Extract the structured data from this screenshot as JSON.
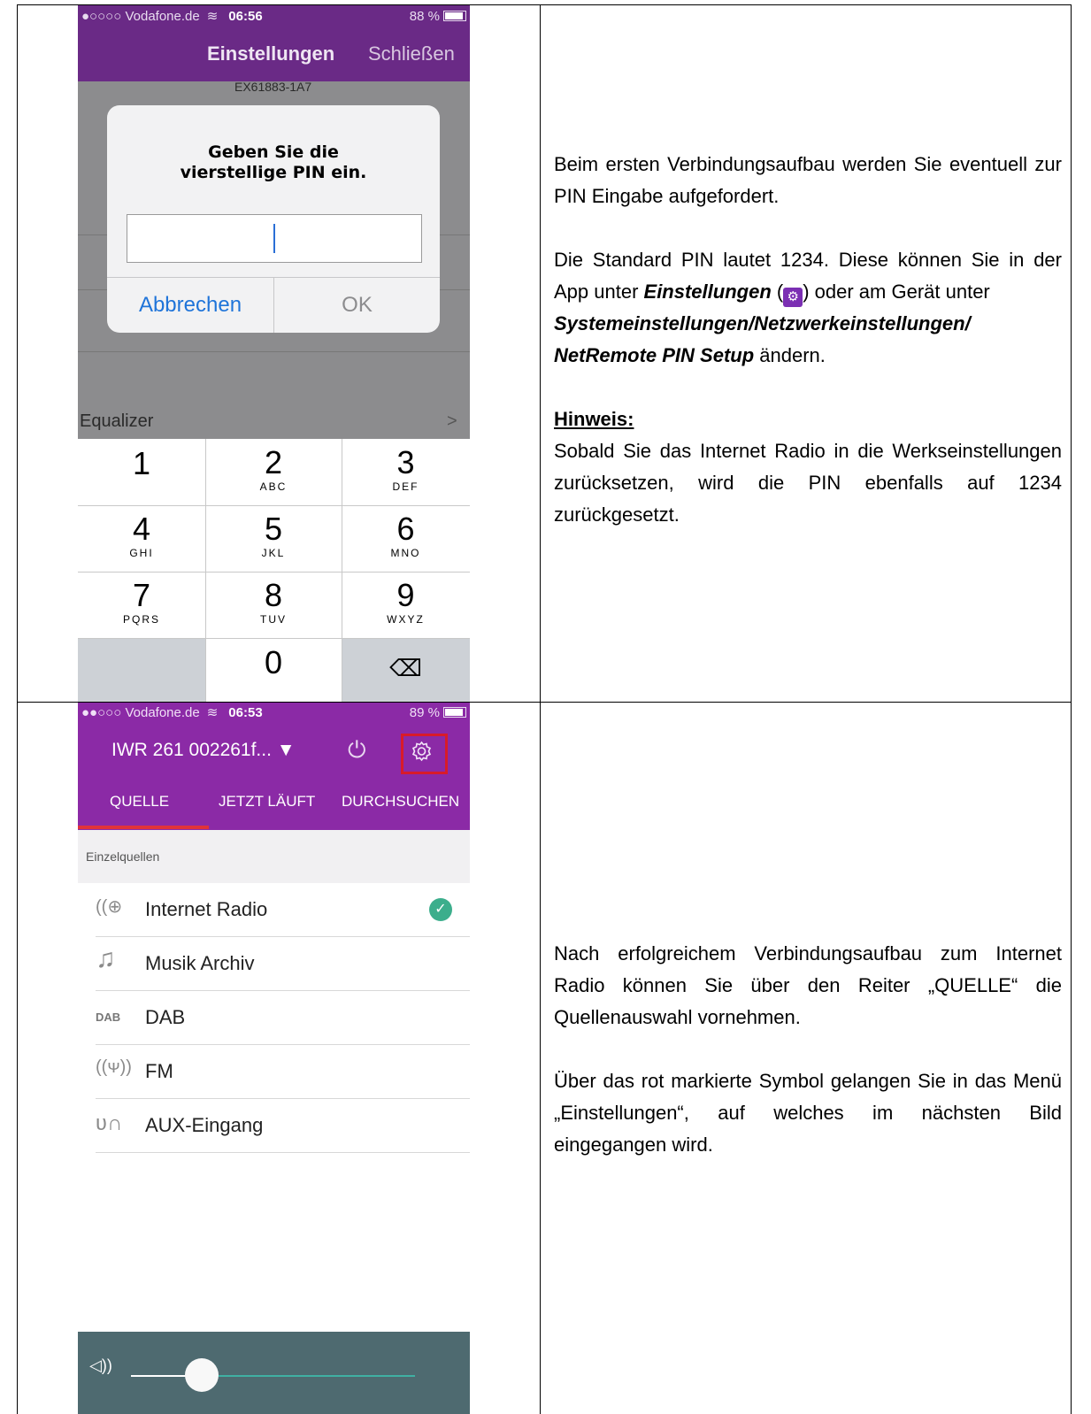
{
  "phone1": {
    "status": {
      "carrier": "●○○○○ Vodafone.de",
      "time": "06:56",
      "battery": "88 %"
    },
    "nav": {
      "title": "Einstellungen",
      "close": "Schließen"
    },
    "background": {
      "device_id": "EX61883-1A7",
      "row_equalizer": "Equalizer",
      "chevron": ">"
    },
    "dialog": {
      "title": "Geben Sie die vierstellige PIN ein.",
      "cancel": "Abbrechen",
      "ok": "OK"
    },
    "keypad": [
      {
        "n": "1",
        "s": ""
      },
      {
        "n": "2",
        "s": "ABC"
      },
      {
        "n": "3",
        "s": "DEF"
      },
      {
        "n": "4",
        "s": "GHI"
      },
      {
        "n": "5",
        "s": "JKL"
      },
      {
        "n": "6",
        "s": "MNO"
      },
      {
        "n": "7",
        "s": "PQRS"
      },
      {
        "n": "8",
        "s": "TUV"
      },
      {
        "n": "9",
        "s": "WXYZ"
      },
      {
        "n": "",
        "s": ""
      },
      {
        "n": "0",
        "s": ""
      },
      {
        "n": "⌫",
        "s": ""
      }
    ]
  },
  "phone2": {
    "status": {
      "carrier": "●●○○○ Vodafone.de",
      "time": "06:53",
      "battery": "89 %"
    },
    "device": "IWR 261 002261f... ▼",
    "tabs": [
      "QUELLE",
      "JETZT LÄUFT",
      "DURCHSUCHEN"
    ],
    "section": "Einzelquellen",
    "sources": [
      {
        "label": "Internet Radio",
        "icon": "internet-radio-icon"
      },
      {
        "label": "Musik Archiv",
        "icon": "music-note-icon"
      },
      {
        "label": "DAB",
        "icon": "dab-icon"
      },
      {
        "label": "FM",
        "icon": "fm-antenna-icon"
      },
      {
        "label": "AUX-Eingang",
        "icon": "aux-plug-icon"
      }
    ],
    "volume_level": 0.25
  },
  "text1": {
    "p1": "Beim ersten Verbindungsaufbau werden Sie eventuell zur PIN Eingabe aufgefordert.",
    "p2a": "Die Standard PIN lautet 1234. Diese können Sie in der App unter ",
    "p2b": "Einstellungen",
    "p2c": " (",
    "p2d": ") oder am Gerät unter",
    "p2e": "Systemeinstellungen/Netzwerkeinstellungen/",
    "p2f": "NetRemote PIN Setup",
    "p2g": " ändern.",
    "hint_title": "Hinweis:",
    "hint": "Sobald Sie das Internet Radio in die Werkseinstellungen zurücksetzen, wird die PIN ebenfalls auf 1234 zurückgesetzt."
  },
  "text2": {
    "p1": "Nach erfolgreichem Verbindungsaufbau zum Internet Radio können Sie über den Reiter „QUELLE“ die Quellenauswahl vornehmen.",
    "p2": "Über das rot markierte Symbol gelangen Sie in das Menü „Einstellungen“, auf welches im nächsten Bild eingegangen wird."
  }
}
